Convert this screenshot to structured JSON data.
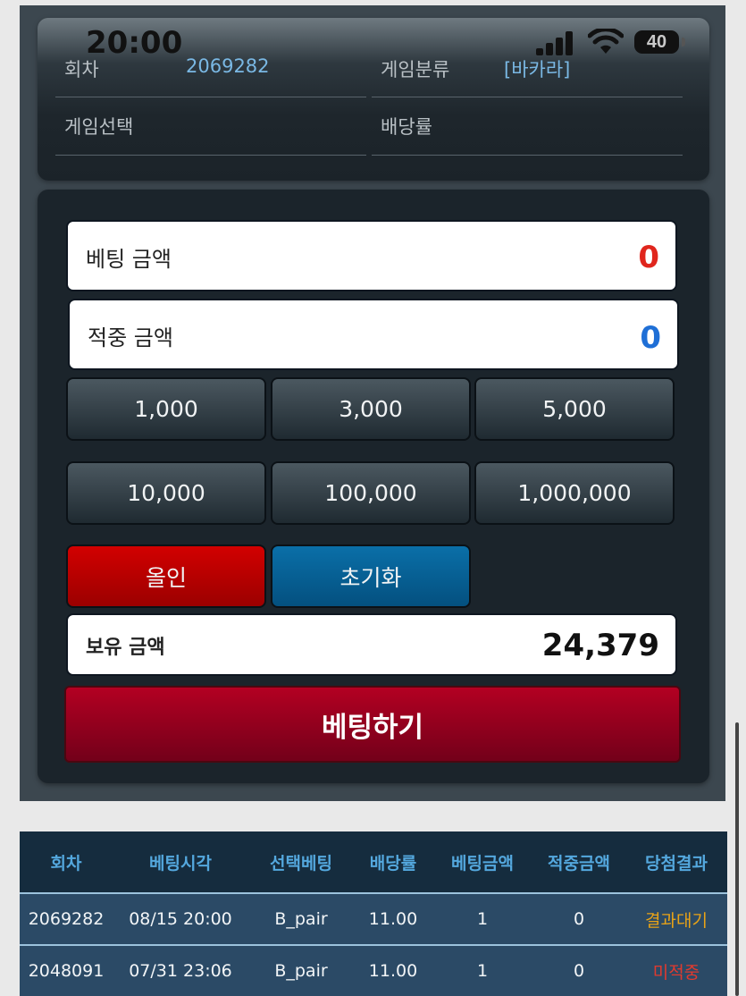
{
  "status_bar": {
    "time": "20:00",
    "battery": "40",
    "signal_icon": "cellular-signal-icon",
    "wifi_icon": "wifi-icon",
    "battery_icon": "battery-icon"
  },
  "game_info": {
    "round_label": "회차",
    "round_value": "2069282",
    "category_label": "게임분류",
    "category_value": "[바카라]",
    "selection_label": "게임선택",
    "odds_label": "배당률"
  },
  "bet": {
    "bet_amount_label": "베팅 금액",
    "bet_amount_value": "0",
    "win_amount_label": "적중 금액",
    "win_amount_value": "0",
    "chips": [
      "1,000",
      "3,000",
      "5,000",
      "10,000",
      "100,000",
      "1,000,000"
    ],
    "all_in_label": "올인",
    "reset_label": "초기화",
    "balance_label": "보유 금액",
    "balance_value": "24,379",
    "submit_label": "베팅하기"
  },
  "history": {
    "columns": [
      "회차",
      "베팅시각",
      "선택베팅",
      "배당률",
      "베팅금액",
      "적중금액",
      "당첨결과"
    ],
    "rows": [
      [
        "2069282",
        "08/15 20:00",
        "B_pair",
        "11.00",
        "1",
        "0",
        "결과대기"
      ],
      [
        "2048091",
        "07/31 23:06",
        "B_pair",
        "11.00",
        "1",
        "0",
        "미적중"
      ]
    ],
    "result_colors": {
      "pending": "#e8a317",
      "miss": "#e23a2e"
    }
  },
  "colors": {
    "bet_amount": "#e0261d",
    "win_amount": "#1f6fd6",
    "balance": "#111111",
    "all_in": "#c40000",
    "reset": "#075f95",
    "submit": "#9d001f",
    "header_text": "#54a8de"
  }
}
